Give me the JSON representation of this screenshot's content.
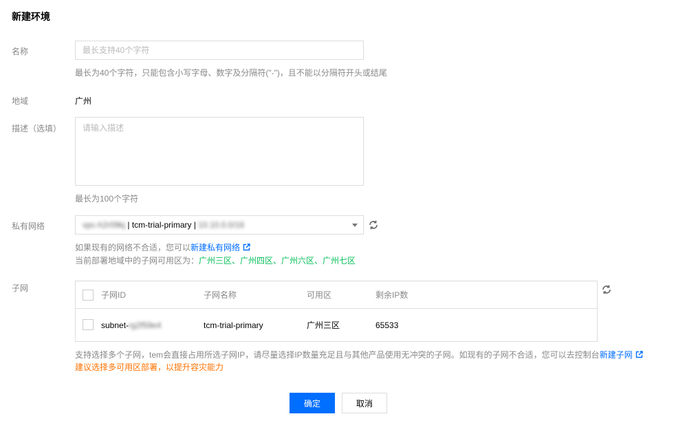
{
  "page": {
    "title": "新建环境"
  },
  "form": {
    "name": {
      "label": "名称",
      "placeholder": "最长支持40个字符",
      "value": "",
      "hint": "最长为40个字符，只能包含小写字母、数字及分隔符(\"-\")，且不能以分隔符开头或结尾"
    },
    "region": {
      "label": "地域",
      "value": "广州"
    },
    "description": {
      "label": "描述（选填）",
      "placeholder": "请输入描述",
      "hint": "最长为100个字符"
    },
    "vpc": {
      "label": "私有网络",
      "vpc_id": "vpc-h2r09kj",
      "sep1": " | ",
      "vpc_name": "tcm-trial-primary",
      "sep2": " | ",
      "cidr": "10.10.0.0/16",
      "hint_prefix": "如果现有的网络不合适，您可以",
      "hint_link": "新建私有网络",
      "zones_prefix": "当前部署地域中的子网可用区为：",
      "zones": "广州三区、广州四区、广州六区、广州七区"
    },
    "subnet": {
      "label": "子网",
      "columns": [
        "子网ID",
        "子网名称",
        "可用区",
        "剩余IP数"
      ],
      "rows": [
        {
          "id_prefix": "subnet-",
          "id_blur": "rg2f59e4",
          "name": "tcm-trial-primary",
          "zone": "广州三区",
          "ips": "65533"
        }
      ],
      "hint_prefix": "支持选择多个子网，tem会直接占用所选子网IP，请尽量选择IP数量充足且与其他产品使用无冲突的子网。如现有的子网不合适，您可以去控制台",
      "hint_link": "新建子网",
      "warning": "建议选择多可用区部署，以提升容灾能力"
    }
  },
  "buttons": {
    "confirm": "确定",
    "cancel": "取消"
  },
  "colors": {
    "primary": "#006eff",
    "green": "#0abf5b",
    "orange": "#ff7200"
  },
  "icons": {
    "refresh": "refresh-icon",
    "external_link": "external-link-icon",
    "caret": "chevron-down-icon"
  }
}
